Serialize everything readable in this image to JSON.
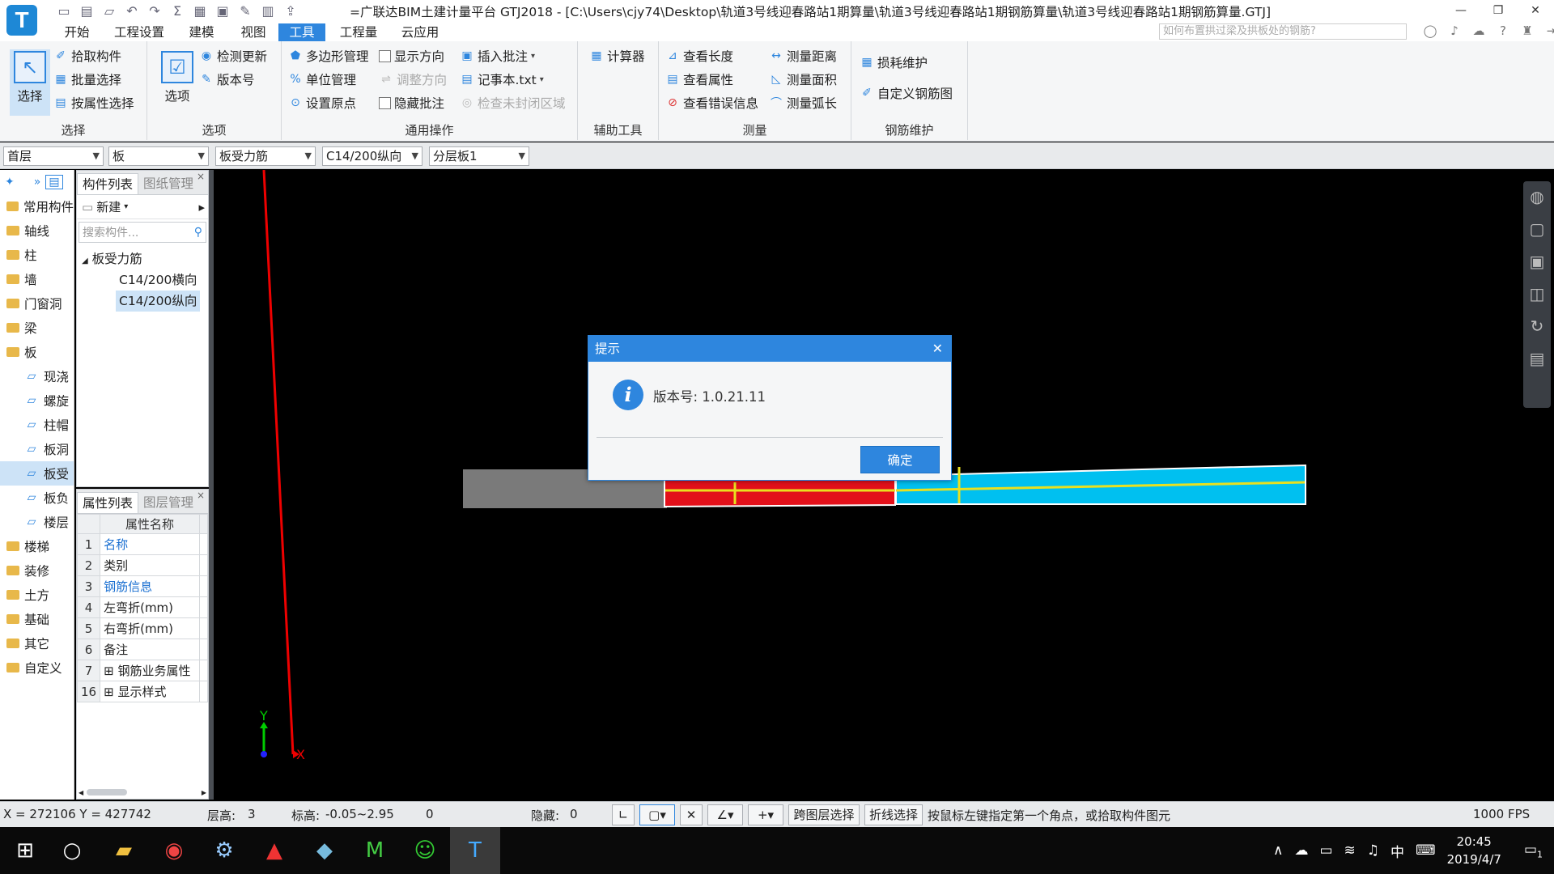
{
  "titlebar": {
    "logo": "T",
    "title": "=广联达BIM土建计量平台 GTJ2018 - [C:\\Users\\cjy74\\Desktop\\轨道3号线迎春路站1期算量\\轨道3号线迎春路站1期钢筋算量\\轨道3号线迎春路站1期钢筋算量.GTJ]",
    "quick_access": [
      "save-icon",
      "new-icon",
      "open-icon",
      "undo-icon",
      "redo-icon",
      "sum-icon",
      "grid-icon",
      "print-icon",
      "pen-icon",
      "table-icon",
      "export-icon"
    ]
  },
  "menubar": {
    "tabs": [
      "开始",
      "工程设置",
      "建模",
      "视图",
      "工具",
      "工程量",
      "云应用"
    ],
    "active": "工具",
    "help_placeholder": "如何布置拱过梁及拱板处的钢筋?"
  },
  "ribbon": {
    "groups": {
      "select": {
        "label": "选择",
        "big": "选择",
        "items": [
          "拾取构件",
          "批量选择",
          "按属性选择"
        ]
      },
      "options": {
        "label": "选项",
        "big": "选项",
        "items": [
          "检测更新",
          "版本号"
        ]
      },
      "general": {
        "label": "通用操作",
        "col1": [
          "多边形管理",
          "单位管理",
          "设置原点"
        ],
        "col2": [
          "显示方向",
          "调整方向",
          "隐藏批注"
        ],
        "col3": [
          "插入批注",
          "记事本.txt",
          "检查未封闭区域"
        ]
      },
      "aux": {
        "label": "辅助工具",
        "items": [
          "计算器"
        ]
      },
      "measure": {
        "label": "测量",
        "col1": [
          "查看长度",
          "查看属性",
          "查看错误信息"
        ],
        "col2": [
          "测量距离",
          "测量面积",
          "测量弧长"
        ]
      },
      "rebar": {
        "label": "钢筋维护",
        "items": [
          "损耗维护",
          "自定义钢筋图"
        ]
      }
    }
  },
  "selectors": [
    "首层",
    "板",
    "板受力筋",
    "C14/200纵向",
    "分层板1"
  ],
  "leftnav": {
    "items": [
      {
        "label": "常用构件",
        "type": "folder"
      },
      {
        "label": "轴线",
        "type": "folder"
      },
      {
        "label": "柱",
        "type": "folder"
      },
      {
        "label": "墙",
        "type": "folder"
      },
      {
        "label": "门窗洞",
        "type": "folder"
      },
      {
        "label": "梁",
        "type": "folder"
      },
      {
        "label": "板",
        "type": "folder"
      },
      {
        "label": "现浇",
        "type": "sub"
      },
      {
        "label": "螺旋",
        "type": "sub"
      },
      {
        "label": "柱帽",
        "type": "sub"
      },
      {
        "label": "板洞",
        "type": "sub"
      },
      {
        "label": "板受",
        "type": "sub",
        "selected": true
      },
      {
        "label": "板负",
        "type": "sub"
      },
      {
        "label": "楼层",
        "type": "sub"
      },
      {
        "label": "楼梯",
        "type": "folder"
      },
      {
        "label": "装修",
        "type": "folder"
      },
      {
        "label": "土方",
        "type": "folder"
      },
      {
        "label": "基础",
        "type": "folder"
      },
      {
        "label": "其它",
        "type": "folder"
      },
      {
        "label": "自定义",
        "type": "folder"
      }
    ]
  },
  "component_panel": {
    "tabs": [
      "构件列表",
      "图纸管理"
    ],
    "new_label": "新建",
    "search_placeholder": "搜索构件...",
    "tree_root": "板受力筋",
    "tree_items": [
      "C14/200横向",
      "C14/200纵向"
    ],
    "selected": "C14/200纵向"
  },
  "property_panel": {
    "tabs": [
      "属性列表",
      "图层管理"
    ],
    "header": "属性名称",
    "rows": [
      {
        "num": "1",
        "name": "名称",
        "link": true
      },
      {
        "num": "2",
        "name": "类别",
        "link": false
      },
      {
        "num": "3",
        "name": "钢筋信息",
        "link": true
      },
      {
        "num": "4",
        "name": "左弯折(mm)",
        "link": false
      },
      {
        "num": "5",
        "name": "右弯折(mm)",
        "link": false
      },
      {
        "num": "6",
        "name": "备注",
        "link": false
      },
      {
        "num": "7",
        "name": "钢筋业务属性",
        "link": false,
        "expand": true
      },
      {
        "num": "16",
        "name": "显示样式",
        "link": false,
        "expand": true
      }
    ]
  },
  "canvas": {
    "axis_y": "Y",
    "axis_x": "X",
    "colors": {
      "slab_gray": "#7a7a7a",
      "slab_red": "#e3101a",
      "slab_cyan": "#00c0f0",
      "rebar_yellow": "#e8e020"
    }
  },
  "dialog": {
    "title": "提示",
    "message": "版本号: 1.0.21.11",
    "ok": "确定"
  },
  "statusbar": {
    "coords": "X = 272106 Y = 427742",
    "floor_height_label": "层高:",
    "floor_height": "3",
    "elevation_label": "标高:",
    "elevation": "-0.05~2.95",
    "count": "0",
    "hidden_label": "隐藏:",
    "hidden": "0",
    "cross_layer": "跨图层选择",
    "polyline_select": "折线选择",
    "hint": "按鼠标左键指定第一个角点，或拾取构件图元",
    "fps": "1000 FPS"
  },
  "taskbar": {
    "time": "20:45",
    "date": "2019/4/7",
    "ime": "中",
    "notifications": "1"
  }
}
